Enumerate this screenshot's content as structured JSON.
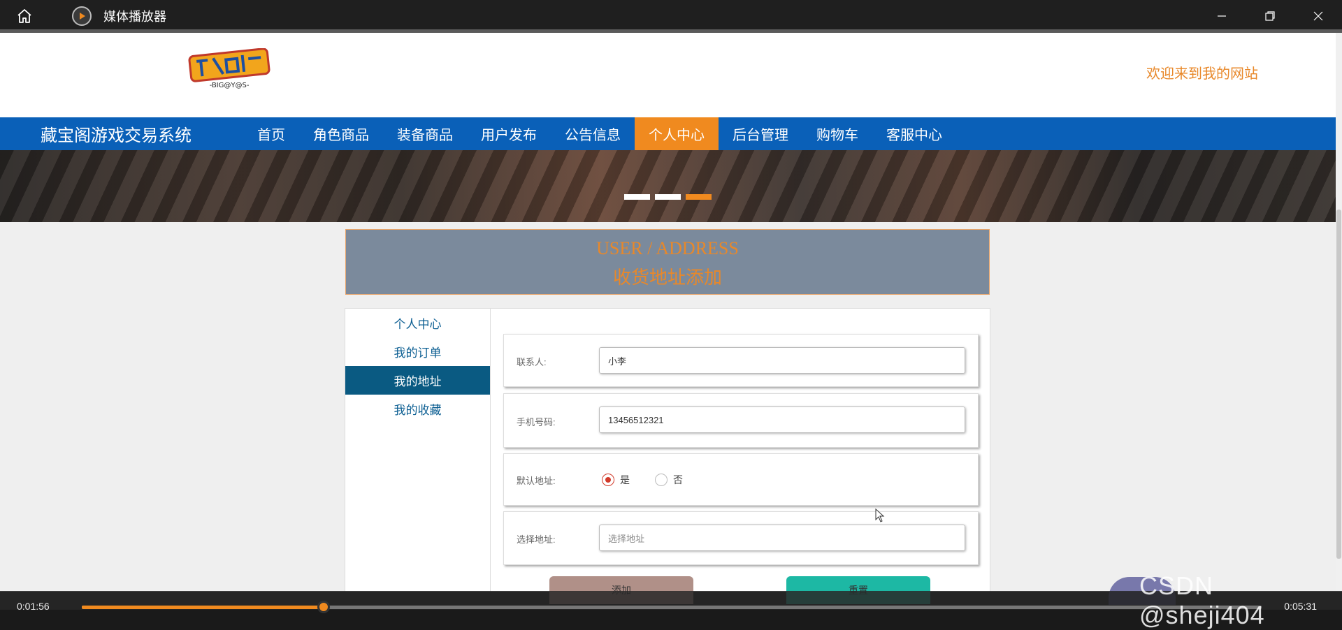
{
  "player": {
    "title": "媒体播放器",
    "time_current": "0:01:56",
    "time_total": "0:05:31",
    "progress": 0.205
  },
  "site": {
    "welcome": "欢迎来到我的网站",
    "brand": "藏宝阁游戏交易系统",
    "logo_text": "-BIG@Y@S-",
    "nav": [
      {
        "label": "首页"
      },
      {
        "label": "角色商品"
      },
      {
        "label": "装备商品"
      },
      {
        "label": "用户发布"
      },
      {
        "label": "公告信息"
      },
      {
        "label": "个人中心"
      },
      {
        "label": "后台管理"
      },
      {
        "label": "购物车"
      },
      {
        "label": "客服中心"
      }
    ],
    "active_nav": "个人中心"
  },
  "section": {
    "title_en": "USER / ADDRESS",
    "title_cn": "收货地址添加"
  },
  "sidebar": {
    "items": [
      {
        "label": "个人中心"
      },
      {
        "label": "我的订单"
      },
      {
        "label": "我的地址"
      },
      {
        "label": "我的收藏"
      }
    ],
    "active": "我的地址"
  },
  "form": {
    "contact_label": "联系人:",
    "contact_value": "小李",
    "phone_label": "手机号码:",
    "phone_value": "13456512321",
    "default_label": "默认地址:",
    "default_yes": "是",
    "default_no": "否",
    "address_label": "选择地址:",
    "address_placeholder": "选择地址",
    "add_button": "添加",
    "reset_button": "重置"
  },
  "watermark": "CSDN @sheji404"
}
